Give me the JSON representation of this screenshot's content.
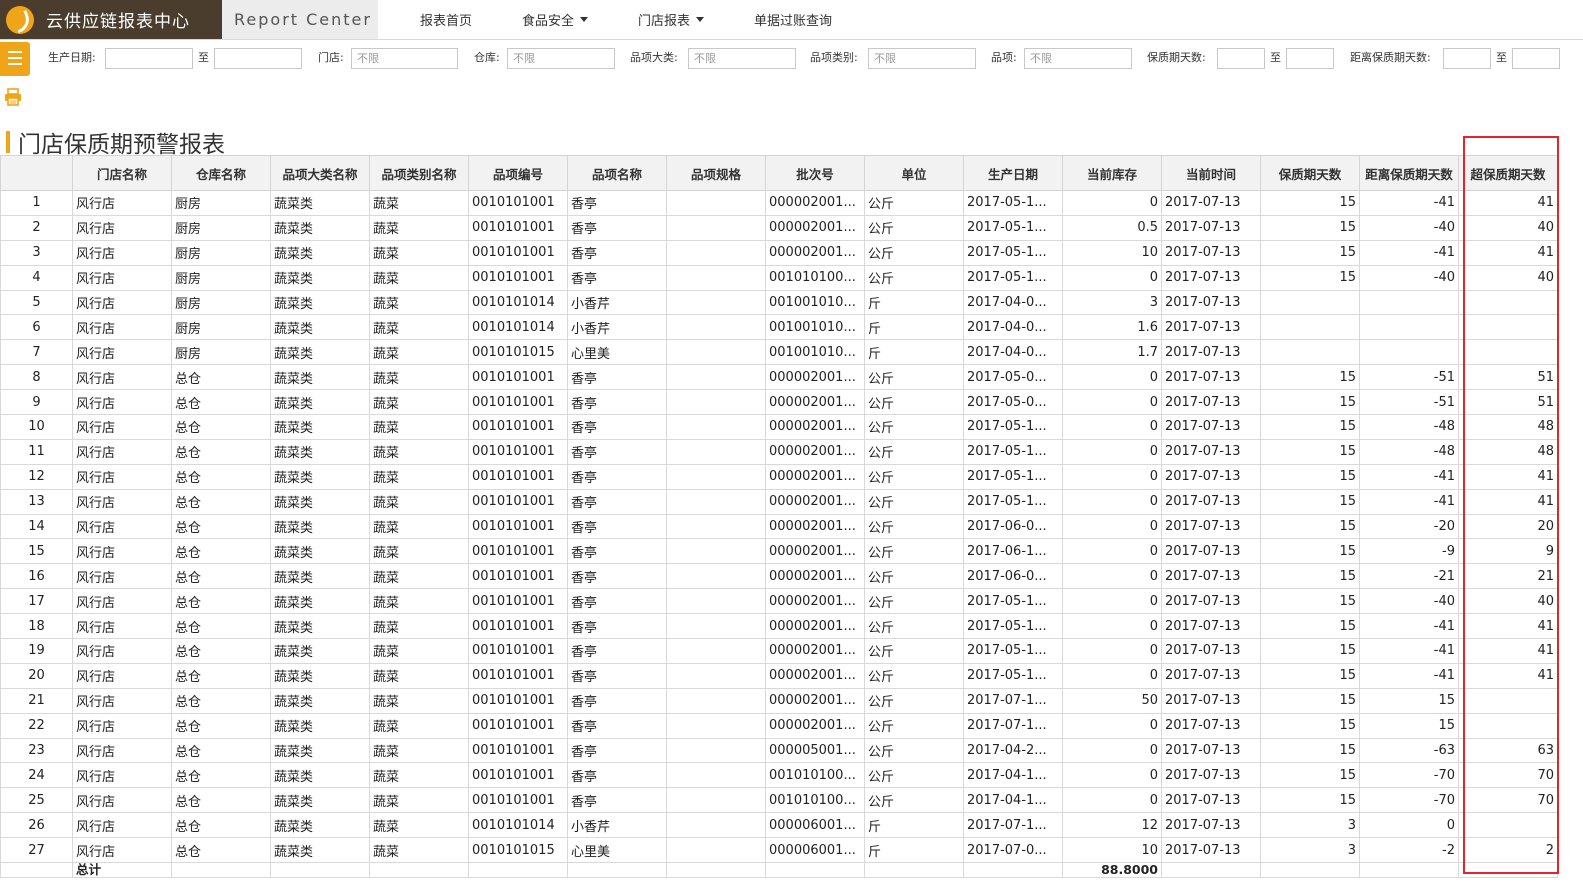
{
  "header": {
    "brand": "云供应链报表中心",
    "subtitle": "Report Center",
    "nav": [
      "报表首页",
      "食品安全",
      "门店报表",
      "单据过账查询"
    ]
  },
  "filters": {
    "production_date_label": "生产日期:",
    "to_label": "至",
    "store_label": "门店:",
    "store_value": "不限",
    "warehouse_label": "仓库:",
    "warehouse_value": "不限",
    "category_label": "品项大类:",
    "category_value": "不限",
    "type_label": "品项类别:",
    "type_value": "不限",
    "item_label": "品项:",
    "item_value": "不限",
    "shelf_days_label": "保质期天数:",
    "distance_label": "距离保质期天数:"
  },
  "page_title": "门店保质期预警报表",
  "table": {
    "columns": [
      "",
      "门店名称",
      "仓库名称",
      "品项大类名称",
      "品项类别名称",
      "品项编号",
      "品项名称",
      "品项规格",
      "批次号",
      "单位",
      "生产日期",
      "当前库存",
      "当前时间",
      "保质期天数",
      "距离保质期天数",
      "超保质期天数"
    ],
    "rows": [
      [
        "1",
        "风行店",
        "厨房",
        "蔬菜类",
        "蔬菜",
        "0010101001",
        "香亭",
        "",
        "000002001...",
        "公斤",
        "2017-05-1...",
        "0",
        "2017-07-13",
        "15",
        "-41",
        "41"
      ],
      [
        "2",
        "风行店",
        "厨房",
        "蔬菜类",
        "蔬菜",
        "0010101001",
        "香亭",
        "",
        "000002001...",
        "公斤",
        "2017-05-1...",
        "0.5",
        "2017-07-13",
        "15",
        "-40",
        "40"
      ],
      [
        "3",
        "风行店",
        "厨房",
        "蔬菜类",
        "蔬菜",
        "0010101001",
        "香亭",
        "",
        "000002001...",
        "公斤",
        "2017-05-1...",
        "10",
        "2017-07-13",
        "15",
        "-41",
        "41"
      ],
      [
        "4",
        "风行店",
        "厨房",
        "蔬菜类",
        "蔬菜",
        "0010101001",
        "香亭",
        "",
        "001010100...",
        "公斤",
        "2017-05-1...",
        "0",
        "2017-07-13",
        "15",
        "-40",
        "40"
      ],
      [
        "5",
        "风行店",
        "厨房",
        "蔬菜类",
        "蔬菜",
        "0010101014",
        "小香芹",
        "",
        "001001010...",
        "斤",
        "2017-04-0...",
        "3",
        "2017-07-13",
        "",
        "",
        ""
      ],
      [
        "6",
        "风行店",
        "厨房",
        "蔬菜类",
        "蔬菜",
        "0010101014",
        "小香芹",
        "",
        "001001010...",
        "斤",
        "2017-04-0...",
        "1.6",
        "2017-07-13",
        "",
        "",
        ""
      ],
      [
        "7",
        "风行店",
        "厨房",
        "蔬菜类",
        "蔬菜",
        "0010101015",
        "心里美",
        "",
        "001001010...",
        "斤",
        "2017-04-0...",
        "1.7",
        "2017-07-13",
        "",
        "",
        ""
      ],
      [
        "8",
        "风行店",
        "总仓",
        "蔬菜类",
        "蔬菜",
        "0010101001",
        "香亭",
        "",
        "000002001...",
        "公斤",
        "2017-05-0...",
        "0",
        "2017-07-13",
        "15",
        "-51",
        "51"
      ],
      [
        "9",
        "风行店",
        "总仓",
        "蔬菜类",
        "蔬菜",
        "0010101001",
        "香亭",
        "",
        "000002001...",
        "公斤",
        "2017-05-0...",
        "0",
        "2017-07-13",
        "15",
        "-51",
        "51"
      ],
      [
        "10",
        "风行店",
        "总仓",
        "蔬菜类",
        "蔬菜",
        "0010101001",
        "香亭",
        "",
        "000002001...",
        "公斤",
        "2017-05-1...",
        "0",
        "2017-07-13",
        "15",
        "-48",
        "48"
      ],
      [
        "11",
        "风行店",
        "总仓",
        "蔬菜类",
        "蔬菜",
        "0010101001",
        "香亭",
        "",
        "000002001...",
        "公斤",
        "2017-05-1...",
        "0",
        "2017-07-13",
        "15",
        "-48",
        "48"
      ],
      [
        "12",
        "风行店",
        "总仓",
        "蔬菜类",
        "蔬菜",
        "0010101001",
        "香亭",
        "",
        "000002001...",
        "公斤",
        "2017-05-1...",
        "0",
        "2017-07-13",
        "15",
        "-41",
        "41"
      ],
      [
        "13",
        "风行店",
        "总仓",
        "蔬菜类",
        "蔬菜",
        "0010101001",
        "香亭",
        "",
        "000002001...",
        "公斤",
        "2017-05-1...",
        "0",
        "2017-07-13",
        "15",
        "-41",
        "41"
      ],
      [
        "14",
        "风行店",
        "总仓",
        "蔬菜类",
        "蔬菜",
        "0010101001",
        "香亭",
        "",
        "000002001...",
        "公斤",
        "2017-06-0...",
        "0",
        "2017-07-13",
        "15",
        "-20",
        "20"
      ],
      [
        "15",
        "风行店",
        "总仓",
        "蔬菜类",
        "蔬菜",
        "0010101001",
        "香亭",
        "",
        "000002001...",
        "公斤",
        "2017-06-1...",
        "0",
        "2017-07-13",
        "15",
        "-9",
        "9"
      ],
      [
        "16",
        "风行店",
        "总仓",
        "蔬菜类",
        "蔬菜",
        "0010101001",
        "香亭",
        "",
        "000002001...",
        "公斤",
        "2017-06-0...",
        "0",
        "2017-07-13",
        "15",
        "-21",
        "21"
      ],
      [
        "17",
        "风行店",
        "总仓",
        "蔬菜类",
        "蔬菜",
        "0010101001",
        "香亭",
        "",
        "000002001...",
        "公斤",
        "2017-05-1...",
        "0",
        "2017-07-13",
        "15",
        "-40",
        "40"
      ],
      [
        "18",
        "风行店",
        "总仓",
        "蔬菜类",
        "蔬菜",
        "0010101001",
        "香亭",
        "",
        "000002001...",
        "公斤",
        "2017-05-1...",
        "0",
        "2017-07-13",
        "15",
        "-41",
        "41"
      ],
      [
        "19",
        "风行店",
        "总仓",
        "蔬菜类",
        "蔬菜",
        "0010101001",
        "香亭",
        "",
        "000002001...",
        "公斤",
        "2017-05-1...",
        "0",
        "2017-07-13",
        "15",
        "-41",
        "41"
      ],
      [
        "20",
        "风行店",
        "总仓",
        "蔬菜类",
        "蔬菜",
        "0010101001",
        "香亭",
        "",
        "000002001...",
        "公斤",
        "2017-05-1...",
        "0",
        "2017-07-13",
        "15",
        "-41",
        "41"
      ],
      [
        "21",
        "风行店",
        "总仓",
        "蔬菜类",
        "蔬菜",
        "0010101001",
        "香亭",
        "",
        "000002001...",
        "公斤",
        "2017-07-1...",
        "50",
        "2017-07-13",
        "15",
        "15",
        ""
      ],
      [
        "22",
        "风行店",
        "总仓",
        "蔬菜类",
        "蔬菜",
        "0010101001",
        "香亭",
        "",
        "000002001...",
        "公斤",
        "2017-07-1...",
        "0",
        "2017-07-13",
        "15",
        "15",
        ""
      ],
      [
        "23",
        "风行店",
        "总仓",
        "蔬菜类",
        "蔬菜",
        "0010101001",
        "香亭",
        "",
        "000005001...",
        "公斤",
        "2017-04-2...",
        "0",
        "2017-07-13",
        "15",
        "-63",
        "63"
      ],
      [
        "24",
        "风行店",
        "总仓",
        "蔬菜类",
        "蔬菜",
        "0010101001",
        "香亭",
        "",
        "001010100...",
        "公斤",
        "2017-04-1...",
        "0",
        "2017-07-13",
        "15",
        "-70",
        "70"
      ],
      [
        "25",
        "风行店",
        "总仓",
        "蔬菜类",
        "蔬菜",
        "0010101001",
        "香亭",
        "",
        "001010100...",
        "公斤",
        "2017-04-1...",
        "0",
        "2017-07-13",
        "15",
        "-70",
        "70"
      ],
      [
        "26",
        "风行店",
        "总仓",
        "蔬菜类",
        "蔬菜",
        "0010101014",
        "小香芹",
        "",
        "000006001...",
        "斤",
        "2017-07-1...",
        "12",
        "2017-07-13",
        "3",
        "0",
        ""
      ],
      [
        "27",
        "风行店",
        "总仓",
        "蔬菜类",
        "蔬菜",
        "0010101015",
        "心里美",
        "",
        "000006001...",
        "斤",
        "2017-07-0...",
        "10",
        "2017-07-13",
        "3",
        "-2",
        "2"
      ]
    ],
    "total_label": "总计",
    "total_stock": "88.8000"
  },
  "colors": {
    "accent": "#f0a418",
    "brand_bg": "#4a3d2e",
    "highlight": "#e0262b"
  }
}
